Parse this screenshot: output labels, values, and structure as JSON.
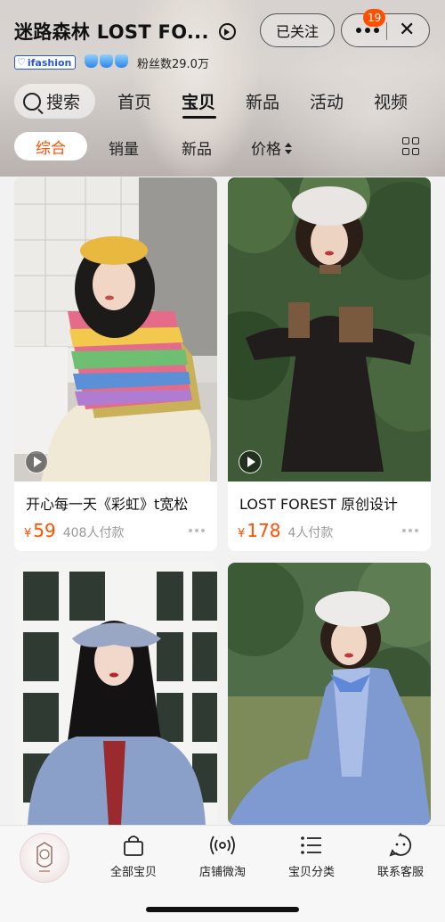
{
  "header": {
    "shop_name": "迷路森林 LOST FO...",
    "follow_label": "已关注",
    "notification_count": "19",
    "close_symbol": "✕",
    "badge_label": "ifashion",
    "fans_label": "粉丝数29.0万"
  },
  "nav": {
    "search_label": "搜索",
    "tabs": [
      "首页",
      "宝贝",
      "新品",
      "活动",
      "视频"
    ],
    "active_tab": "宝贝"
  },
  "sub_tabs": {
    "active": "综合",
    "items": [
      "销量",
      "新品",
      "价格"
    ]
  },
  "products": [
    {
      "title": "开心每一天《彩虹》t宽松",
      "currency": "¥",
      "price": "59",
      "sold": "408人付款",
      "has_video": true
    },
    {
      "title": "LOST FOREST 原创设计",
      "currency": "¥",
      "price": "178",
      "sold": "4人付款",
      "has_video": true
    },
    {
      "title": "",
      "currency": "",
      "price": "",
      "sold": "",
      "has_video": false
    },
    {
      "title": "",
      "currency": "",
      "price": "",
      "sold": "",
      "has_video": false
    }
  ],
  "bottom_bar": {
    "items": [
      "全部宝贝",
      "店铺微淘",
      "宝贝分类",
      "联系客服"
    ]
  },
  "colors": {
    "accent": "#ff5000",
    "text": "#222222",
    "muted": "#999999"
  }
}
